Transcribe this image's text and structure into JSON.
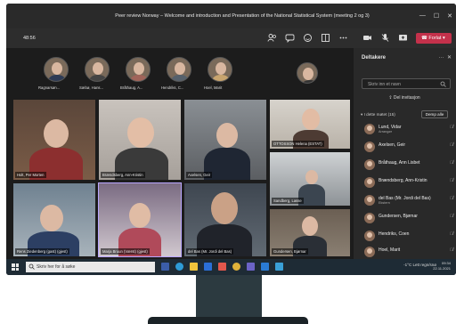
{
  "window": {
    "title": "Peer review Norway – Welcome and introduction and Presentation of the National Statistical System (meeting 2 og 3)",
    "controls": [
      "—",
      "☐",
      "✕"
    ]
  },
  "toolbar": {
    "timer": "48:56",
    "leave_label": "Forlat"
  },
  "together_row": [
    {
      "name": "Ragnarsøn..."
    },
    {
      "name": "Sæbø, Hans..."
    },
    {
      "name": "Bråthaug, A..."
    },
    {
      "name": "Hendriks, C..."
    },
    {
      "name": "Hoel, Marit"
    }
  ],
  "tiles": [
    {
      "name": "Holt, Per Morten"
    },
    {
      "name": "Brændsberg, Ann-Kristin"
    },
    {
      "name": "Axelsen, Geir"
    },
    {
      "name": "OTTOSSON Helena (ESTAT)"
    },
    {
      "name": "Sandberg, Lasse"
    },
    {
      "name": "Rens Ziedenberg (gast) (gjest)"
    },
    {
      "name": "Marja Bruun (Værst) (gjest)"
    },
    {
      "name": "del Bas (Mr. Jordi del Bas)"
    },
    {
      "name": "Gundersen, Bjørnar"
    }
  ],
  "participants_panel": {
    "title": "Deltakere",
    "search_placeholder": "Skriv inn et navn",
    "share_label": "Del invitasjon",
    "section_label": "I dette møtet (15)",
    "mute_all_label": "Demp alle",
    "people": [
      {
        "name": "Lund, Vidar",
        "role": "Arrangør"
      },
      {
        "name": "Axelsen, Geir",
        "role": ""
      },
      {
        "name": "Bråthaug, Ann Lisbet",
        "role": ""
      },
      {
        "name": "Brændsberg, Ann-Kristin",
        "role": ""
      },
      {
        "name": "del Bas (Mr. Jordi del Bas)",
        "role": "Ekstern"
      },
      {
        "name": "Gundersen, Bjørnar",
        "role": ""
      },
      {
        "name": "Hendriks, Coen",
        "role": ""
      },
      {
        "name": "Hoel, Marit",
        "role": ""
      }
    ]
  },
  "taskbar": {
    "search_placeholder": "Skriv her for å søke",
    "tray_text": "-1°C  Lett regn/snø",
    "time": "09:34",
    "date": "22.11.2021"
  }
}
